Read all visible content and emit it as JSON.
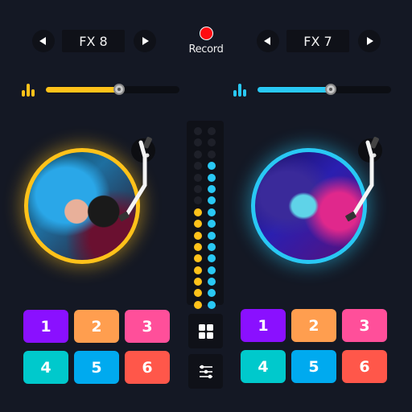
{
  "colors": {
    "background": "#141824",
    "left_accent": "#ffc21a",
    "right_accent": "#29c8f4",
    "record": "#ff0a10",
    "led_off": "#1e2029"
  },
  "record": {
    "label": "Record"
  },
  "left_deck": {
    "fx_label": "FX 8",
    "prev_icon": "triangle-left-icon",
    "next_icon": "triangle-right-icon",
    "volume": 0.55,
    "pads": [
      {
        "label": "1",
        "color": "#8a10ff"
      },
      {
        "label": "2",
        "color": "#ff9e4f"
      },
      {
        "label": "3",
        "color": "#ff4f9a"
      },
      {
        "label": "4",
        "color": "#00c9cc"
      },
      {
        "label": "5",
        "color": "#00aaef"
      },
      {
        "label": "6",
        "color": "#ff574a"
      }
    ]
  },
  "right_deck": {
    "fx_label": "FX 7",
    "prev_icon": "triangle-left-icon",
    "next_icon": "triangle-right-icon",
    "volume": 0.55,
    "pads": [
      {
        "label": "1",
        "color": "#8a10ff"
      },
      {
        "label": "2",
        "color": "#ff9e4f"
      },
      {
        "label": "3",
        "color": "#ff4f9a"
      },
      {
        "label": "4",
        "color": "#00c9cc"
      },
      {
        "label": "5",
        "color": "#00aaef"
      },
      {
        "label": "6",
        "color": "#ff574a"
      }
    ]
  },
  "level_meter": {
    "total_leds": 16,
    "left_lit": 9,
    "right_lit": 13
  },
  "center_controls": [
    {
      "name": "grid-button",
      "icon": "grid-icon"
    },
    {
      "name": "mixer-settings-button",
      "icon": "sliders-icon"
    }
  ]
}
